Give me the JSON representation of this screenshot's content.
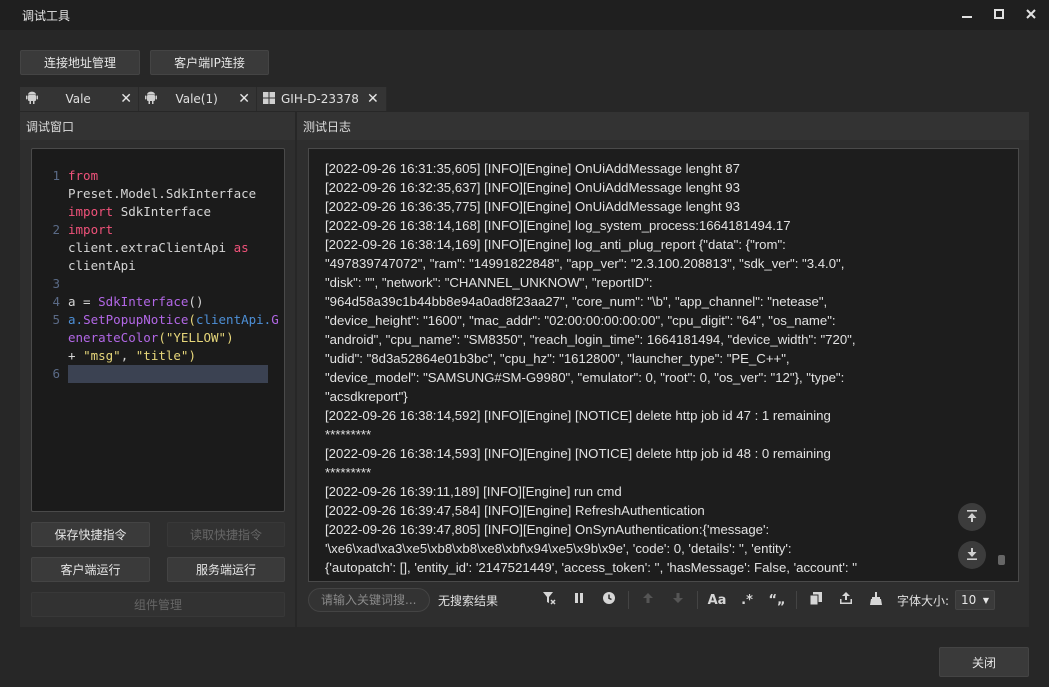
{
  "window": {
    "title": "调试工具"
  },
  "toolbar": {
    "conn_manage": "连接地址管理",
    "client_ip": "客户端IP连接"
  },
  "tabs": [
    {
      "label": "Vale",
      "icon": "android-icon"
    },
    {
      "label": "Vale(1)",
      "icon": "android-icon"
    },
    {
      "label": "GIH-D-23378",
      "icon": "windows-icon"
    }
  ],
  "debug_panel": {
    "title": "调试窗口"
  },
  "log_panel": {
    "title": "测试日志"
  },
  "editor": {
    "line_numbers": [
      "1",
      "2",
      "3",
      "4",
      "5",
      "6"
    ],
    "l1_kw1": "from",
    "l1_mod": "Preset.Model.SdkInterface",
    "l1_kw2": "import",
    "l1_name": "SdkInterface",
    "l2_kw1": "import",
    "l2_mod": "client.extraClientApi",
    "l2_kw2": "as",
    "l2_name": "clientApi",
    "l4_pre": "a = ",
    "l4_fn": "SdkInterface",
    "l4_post": "()",
    "l5_obj": "a.",
    "l5_fn": "SetPopupNotice",
    "l5_p1": "(",
    "l5_arg": "clientApi.",
    "l5_fn2": "GenerateColor",
    "l5_p2": "(",
    "l5_str1": "\"YELLOW\"",
    "l5_p3": ")",
    "l5_plus": "+ ",
    "l5_str2": "\"msg\"",
    "l5_comma": ", ",
    "l5_str3": "\"title\"",
    "l5_p4": ")"
  },
  "buttons": {
    "save_cmd": "保存快捷指令",
    "read_cmd": "读取快捷指令",
    "client_run": "客户端运行",
    "server_run": "服务端运行",
    "component_manage": "组件管理",
    "close": "关闭"
  },
  "log_lines": [
    "[2022-09-26 16:31:35,605] [INFO][Engine] OnUiAddMessage lenght 87",
    "[2022-09-26 16:32:35,637] [INFO][Engine] OnUiAddMessage lenght 93",
    "[2022-09-26 16:36:35,775] [INFO][Engine] OnUiAddMessage lenght 93",
    "[2022-09-26 16:38:14,168] [INFO][Engine] log_system_process:1664181494.17",
    "[2022-09-26 16:38:14,169] [INFO][Engine] log_anti_plug_report {\"data\": {\"rom\":\n\"497839747072\", \"ram\": \"14991822848\", \"app_ver\": \"2.3.100.208813\", \"sdk_ver\": \"3.4.0\",\n\"disk\": \"\", \"network\": \"CHANNEL_UNKNOW\", \"reportID\":\n\"964d58a39c1b44bb8e94a0ad8f23aa27\", \"core_num\": \"\\b\", \"app_channel\": \"netease\",\n\"device_height\": \"1600\", \"mac_addr\": \"02:00:00:00:00:00\", \"cpu_digit\": \"64\", \"os_name\":\n\"android\", \"cpu_name\": \"SM8350\", \"reach_login_time\": 1664181494, \"device_width\": \"720\",\n\"udid\": \"8d3a52864e01b3bc\", \"cpu_hz\": \"1612800\", \"launcher_type\": \"PE_C++\",\n\"device_model\": \"SAMSUNG#SM-G9980\", \"emulator\": 0, \"root\": 0, \"os_ver\": \"12\"}, \"type\":\n\"acsdkreport\"}",
    "[2022-09-26 16:38:14,592] [INFO][Engine] [NOTICE] delete http job id 47 : 1 remaining\n*********",
    "[2022-09-26 16:38:14,593] [INFO][Engine] [NOTICE] delete http job id 48 : 0 remaining\n*********",
    "[2022-09-26 16:39:11,189] [INFO][Engine] run cmd",
    "[2022-09-26 16:39:47,584] [INFO][Engine] RefreshAuthentication",
    "[2022-09-26 16:39:47,805] [INFO][Engine] OnSynAuthentication:{'message':\n'\\xe6\\xad\\xa3\\xe5\\xb8\\xb8\\xe8\\xbf\\x94\\xe5\\x9b\\x9e', 'code': 0, 'details': '', 'entity':\n{'autopatch': [], 'entity_id': '2147521449', 'access_token': '', 'hasMessage': False, 'account': ''"
  ],
  "search": {
    "placeholder": "请输入关键词搜...",
    "result": "无搜索结果"
  },
  "font_size": {
    "label": "字体大小:",
    "value": "10"
  },
  "tool_labels": {
    "case": "Aa",
    "regex": ".*",
    "quote": "“„"
  }
}
